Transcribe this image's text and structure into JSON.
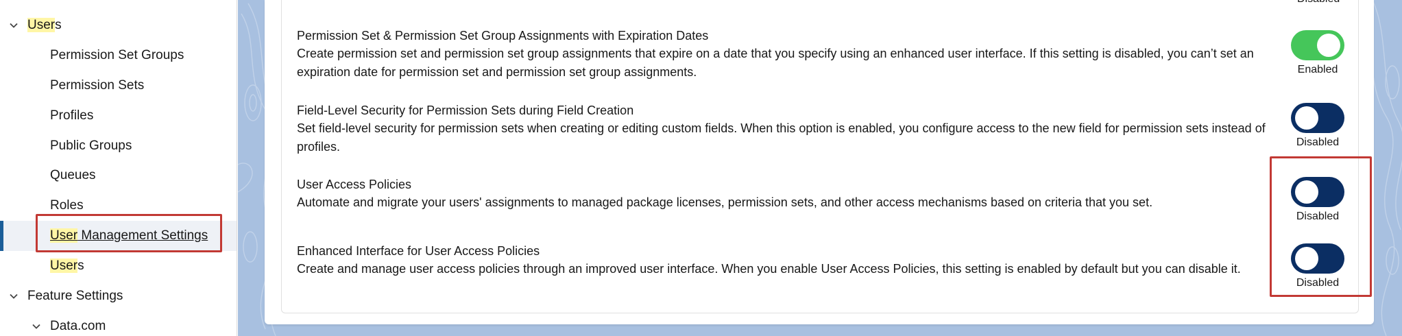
{
  "sidebar": {
    "users_group": {
      "label_hl": "User",
      "label_rest": "s"
    },
    "items": [
      {
        "label": "Permission Set Groups"
      },
      {
        "label": "Permission Sets"
      },
      {
        "label": "Profiles"
      },
      {
        "label": "Public Groups"
      },
      {
        "label": "Queues"
      },
      {
        "label": "Roles"
      }
    ],
    "user_mgmt": {
      "label_hl": "User",
      "label_rest": " Management Settings"
    },
    "users_item": {
      "label_hl": "User",
      "label_rest": "s"
    },
    "feature_settings": {
      "label": "Feature Settings"
    },
    "datacom": {
      "label": "Data.com"
    }
  },
  "main": {
    "top_partial_status": "Disabled",
    "settings": [
      {
        "title": "Permission Set & Permission Set Group Assignments with Expiration Dates",
        "desc": "Create permission set and permission set group assignments that expire on a date that you specify using an enhanced user interface. If this setting is disabled, you can’t set an expiration date for permission set and permission set group assignments.",
        "status": "Enabled",
        "enabled": true
      },
      {
        "title": "Field-Level Security for Permission Sets during Field Creation",
        "desc": "Set field-level security for permission sets when creating or editing custom fields. When this option is enabled, you configure access to the new field for permission sets instead of profiles.",
        "status": "Disabled",
        "enabled": false
      },
      {
        "title": "User Access Policies",
        "desc": "Automate and migrate your users' assignments to managed package licenses, permission sets, and other access mechanisms based on criteria that you set.",
        "status": "Disabled",
        "enabled": false
      },
      {
        "title": "Enhanced Interface for User Access Policies",
        "desc": "Create and manage user access policies through an improved user interface. When you enable User Access Policies, this setting is enabled by default but you can disable it.",
        "status": "Disabled",
        "enabled": false
      }
    ]
  },
  "colors": {
    "toggle_on": "#45c65a",
    "toggle_off": "#0b2e63",
    "highlight": "#fff6a6",
    "annotation_red": "#c23934",
    "selection_bar": "#1b5e99"
  }
}
